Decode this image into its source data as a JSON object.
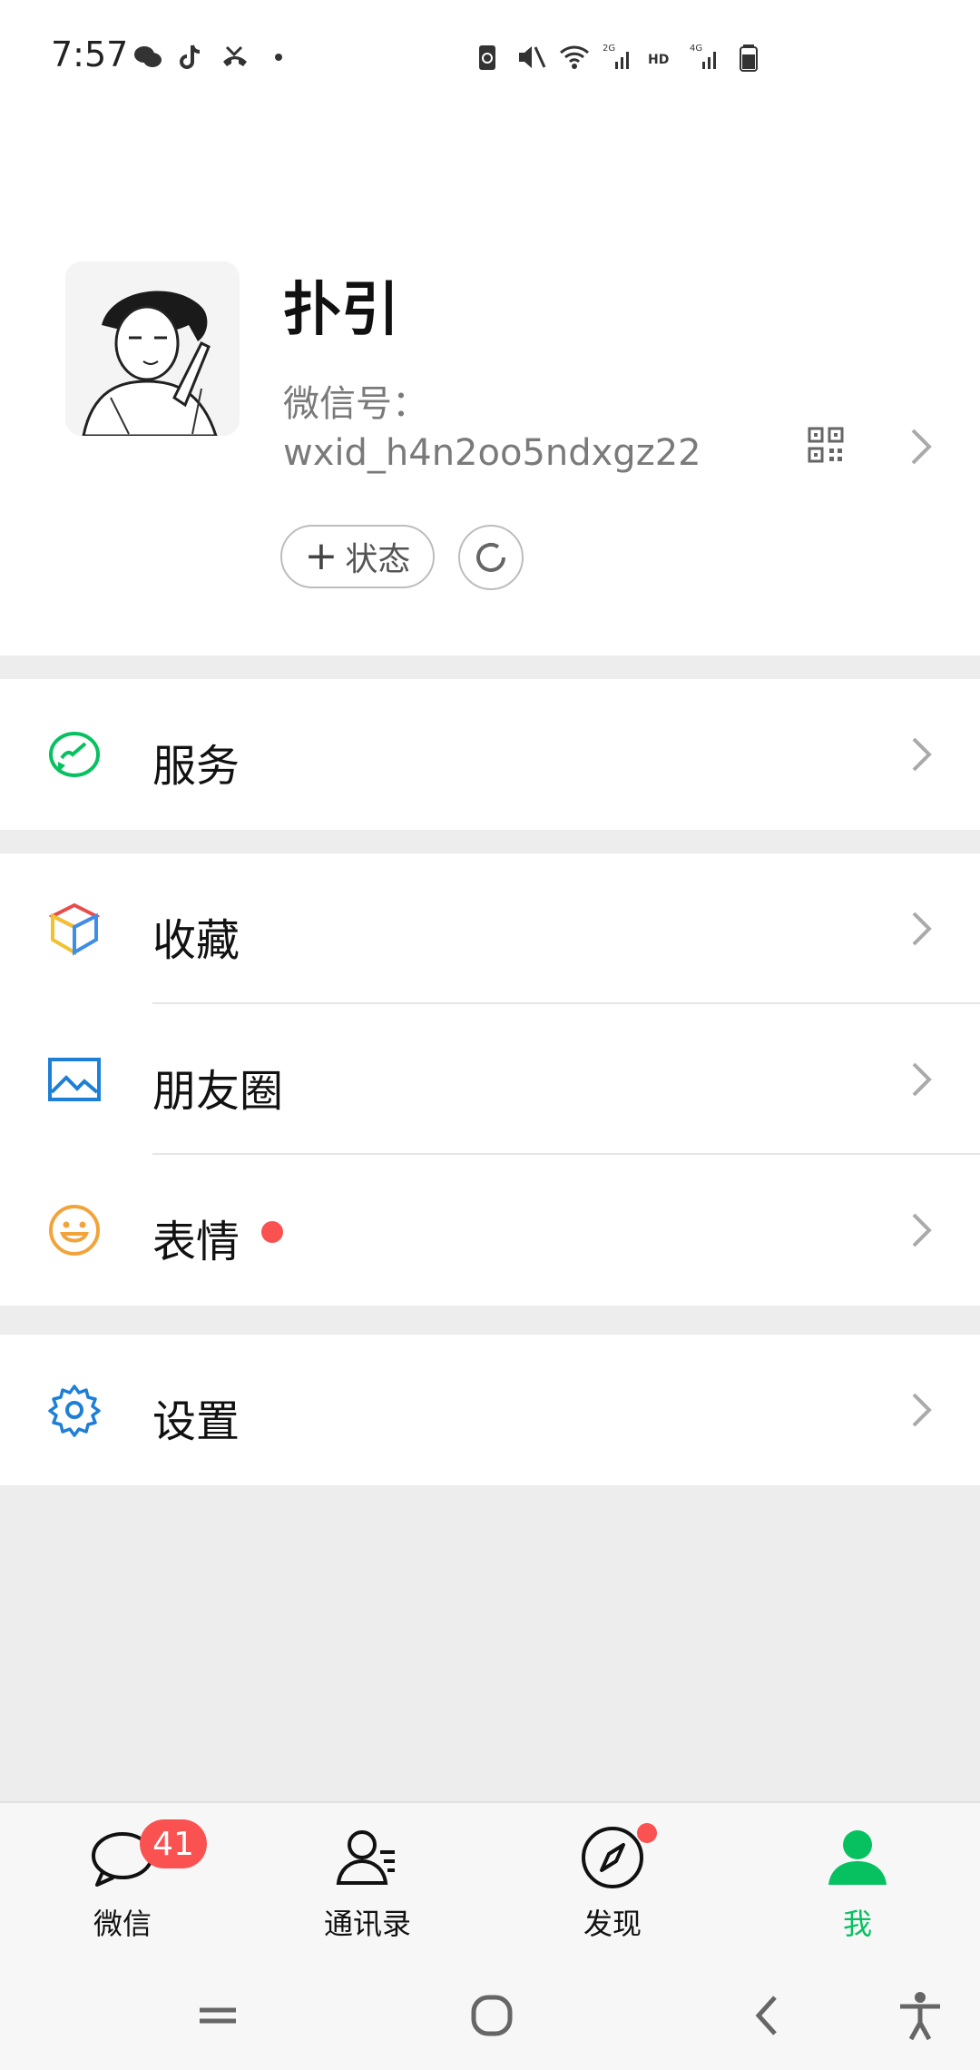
{
  "status_bar": {
    "time": "7:57",
    "icons_left": [
      "wechat-icon",
      "tiktok-icon",
      "missed-call-icon",
      "dot-icon"
    ],
    "icons_right": [
      "battery-saver-icon",
      "mute-icon",
      "wifi-icon",
      "signal-2g-icon",
      "hd-icon",
      "signal-4g-icon",
      "battery-icon"
    ],
    "hd_label": "HD",
    "net2g": "2G",
    "net4g": "4G"
  },
  "profile": {
    "name": "扑引",
    "wxid_label": "微信号：",
    "wxid_value": "wxid_h4n2oo5ndxgz22",
    "status_button_label": "状态",
    "status_plus": "+"
  },
  "menu": {
    "services": "服务",
    "favorites": "收藏",
    "moments": "朋友圈",
    "stickers": "表情",
    "settings": "设置"
  },
  "tabbar": {
    "tabs": [
      {
        "label": "微信",
        "badge": "41"
      },
      {
        "label": "通讯录"
      },
      {
        "label": "发现"
      },
      {
        "label": "我"
      }
    ]
  },
  "colors": {
    "accent_green": "#07c160",
    "badge_red": "#fa5151",
    "service_green": "#07c160",
    "settings_blue": "#1e7fd6",
    "sticker_orange": "#f2a33a"
  }
}
